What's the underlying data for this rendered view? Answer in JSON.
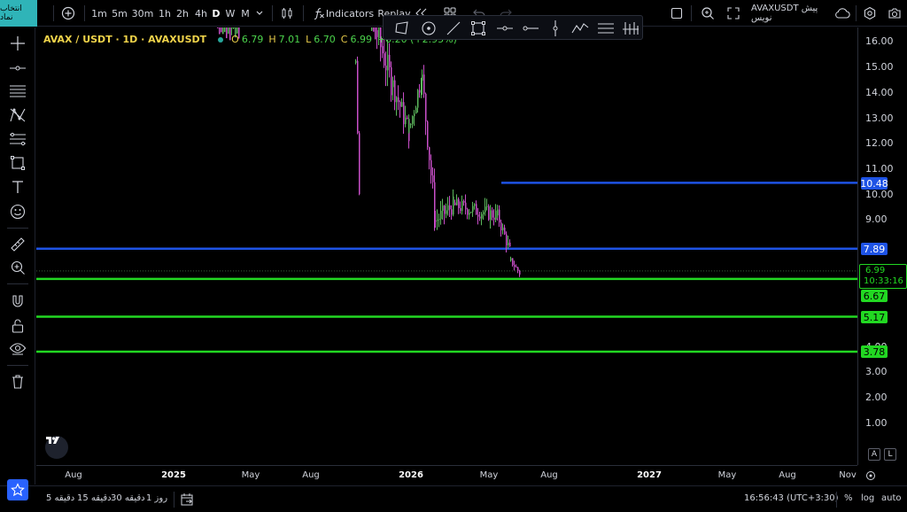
{
  "topbar": {
    "symbol_search": "انتخاب نماد",
    "intervals": [
      "1m",
      "5m",
      "30m",
      "1h",
      "2h",
      "4h",
      "D",
      "W",
      "M"
    ],
    "active_interval": "D",
    "indicators": "Indicators",
    "replay": "Replay",
    "prep_label": "AVAXUSDT پیش نویس"
  },
  "legend": {
    "symbol": "AVAX / USDT · 1D · AVAXUSDT",
    "o_label": "O",
    "o_value": "6.79",
    "h_label": "H",
    "h_value": "7.01",
    "l_label": "L",
    "l_value": "6.70",
    "c_label": "C",
    "c_value": "6.99",
    "change": "+0.20 (+2.95%)"
  },
  "price_axis": {
    "ticks": [
      "16.00",
      "15.00",
      "14.00",
      "13.00",
      "12.00",
      "11.00",
      "10.00",
      "9.00",
      "4.00",
      "3.00",
      "2.00",
      "1.00"
    ],
    "labels": {
      "blue_upper": "10.48",
      "blue_lower": "7.89",
      "current": "6.99",
      "countdown": "10:33:16",
      "green_upper": "6.67",
      "green_mid": "5.17",
      "green_lower": "3.78"
    }
  },
  "time_axis": {
    "ticks": [
      "Aug",
      "2025",
      "May",
      "Aug",
      "2026",
      "May",
      "Aug",
      "2027",
      "May",
      "Aug",
      "Nov"
    ]
  },
  "bottombar": {
    "ranges": [
      "5 دقیقه",
      "15 دقیقه",
      "30 دقیقه",
      "1 روز"
    ],
    "clock": "16:56:43 (UTC+3:30)",
    "percent": "%",
    "log": "log",
    "auto": "auto",
    "a_btn": "A",
    "l_btn": "L"
  },
  "colors": {
    "blue_line": "#1e53e5",
    "green_line": "#22d822",
    "candle_up": "#5cb85c",
    "candle_down": "#c94fc9",
    "accent": "#2fb4b8"
  },
  "chart_data": {
    "type": "candlestick",
    "symbol": "AVAX / USDT",
    "interval": "1D",
    "yticks": [
      16,
      15,
      14,
      13,
      12,
      11,
      10,
      9,
      4,
      3,
      2,
      1
    ],
    "horizontal_levels": [
      {
        "price": 10.48,
        "color": "blue"
      },
      {
        "price": 7.89,
        "color": "blue"
      },
      {
        "price": 6.67,
        "color": "green"
      },
      {
        "price": 5.17,
        "color": "green"
      },
      {
        "price": 3.78,
        "color": "green"
      }
    ],
    "last_price": 6.99
  }
}
